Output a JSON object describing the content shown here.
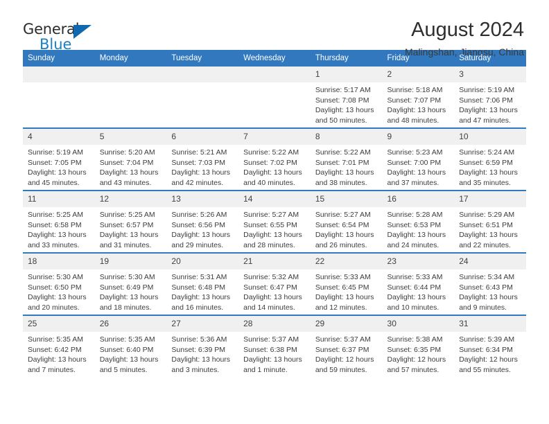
{
  "brand": {
    "name_top": "General",
    "name_bottom": "Blue",
    "mark": "triangle-logo"
  },
  "header": {
    "title": "August 2024",
    "subtitle": "Malingshan, Jiangsu, China"
  },
  "colors": {
    "header_bar": "#3278be",
    "brand_blue": "#1b7fc4",
    "daynum_bg": "#f0f0f0",
    "text": "#3c3c3c"
  },
  "weekdays": [
    "Sunday",
    "Monday",
    "Tuesday",
    "Wednesday",
    "Thursday",
    "Friday",
    "Saturday"
  ],
  "weeks": [
    [
      {
        "day": "",
        "sunrise": "",
        "sunset": "",
        "daylight_line1": "",
        "daylight_line2": ""
      },
      {
        "day": "",
        "sunrise": "",
        "sunset": "",
        "daylight_line1": "",
        "daylight_line2": ""
      },
      {
        "day": "",
        "sunrise": "",
        "sunset": "",
        "daylight_line1": "",
        "daylight_line2": ""
      },
      {
        "day": "",
        "sunrise": "",
        "sunset": "",
        "daylight_line1": "",
        "daylight_line2": ""
      },
      {
        "day": "1",
        "sunrise": "Sunrise: 5:17 AM",
        "sunset": "Sunset: 7:08 PM",
        "daylight_line1": "Daylight: 13 hours",
        "daylight_line2": "and 50 minutes."
      },
      {
        "day": "2",
        "sunrise": "Sunrise: 5:18 AM",
        "sunset": "Sunset: 7:07 PM",
        "daylight_line1": "Daylight: 13 hours",
        "daylight_line2": "and 48 minutes."
      },
      {
        "day": "3",
        "sunrise": "Sunrise: 5:19 AM",
        "sunset": "Sunset: 7:06 PM",
        "daylight_line1": "Daylight: 13 hours",
        "daylight_line2": "and 47 minutes."
      }
    ],
    [
      {
        "day": "4",
        "sunrise": "Sunrise: 5:19 AM",
        "sunset": "Sunset: 7:05 PM",
        "daylight_line1": "Daylight: 13 hours",
        "daylight_line2": "and 45 minutes."
      },
      {
        "day": "5",
        "sunrise": "Sunrise: 5:20 AM",
        "sunset": "Sunset: 7:04 PM",
        "daylight_line1": "Daylight: 13 hours",
        "daylight_line2": "and 43 minutes."
      },
      {
        "day": "6",
        "sunrise": "Sunrise: 5:21 AM",
        "sunset": "Sunset: 7:03 PM",
        "daylight_line1": "Daylight: 13 hours",
        "daylight_line2": "and 42 minutes."
      },
      {
        "day": "7",
        "sunrise": "Sunrise: 5:22 AM",
        "sunset": "Sunset: 7:02 PM",
        "daylight_line1": "Daylight: 13 hours",
        "daylight_line2": "and 40 minutes."
      },
      {
        "day": "8",
        "sunrise": "Sunrise: 5:22 AM",
        "sunset": "Sunset: 7:01 PM",
        "daylight_line1": "Daylight: 13 hours",
        "daylight_line2": "and 38 minutes."
      },
      {
        "day": "9",
        "sunrise": "Sunrise: 5:23 AM",
        "sunset": "Sunset: 7:00 PM",
        "daylight_line1": "Daylight: 13 hours",
        "daylight_line2": "and 37 minutes."
      },
      {
        "day": "10",
        "sunrise": "Sunrise: 5:24 AM",
        "sunset": "Sunset: 6:59 PM",
        "daylight_line1": "Daylight: 13 hours",
        "daylight_line2": "and 35 minutes."
      }
    ],
    [
      {
        "day": "11",
        "sunrise": "Sunrise: 5:25 AM",
        "sunset": "Sunset: 6:58 PM",
        "daylight_line1": "Daylight: 13 hours",
        "daylight_line2": "and 33 minutes."
      },
      {
        "day": "12",
        "sunrise": "Sunrise: 5:25 AM",
        "sunset": "Sunset: 6:57 PM",
        "daylight_line1": "Daylight: 13 hours",
        "daylight_line2": "and 31 minutes."
      },
      {
        "day": "13",
        "sunrise": "Sunrise: 5:26 AM",
        "sunset": "Sunset: 6:56 PM",
        "daylight_line1": "Daylight: 13 hours",
        "daylight_line2": "and 29 minutes."
      },
      {
        "day": "14",
        "sunrise": "Sunrise: 5:27 AM",
        "sunset": "Sunset: 6:55 PM",
        "daylight_line1": "Daylight: 13 hours",
        "daylight_line2": "and 28 minutes."
      },
      {
        "day": "15",
        "sunrise": "Sunrise: 5:27 AM",
        "sunset": "Sunset: 6:54 PM",
        "daylight_line1": "Daylight: 13 hours",
        "daylight_line2": "and 26 minutes."
      },
      {
        "day": "16",
        "sunrise": "Sunrise: 5:28 AM",
        "sunset": "Sunset: 6:53 PM",
        "daylight_line1": "Daylight: 13 hours",
        "daylight_line2": "and 24 minutes."
      },
      {
        "day": "17",
        "sunrise": "Sunrise: 5:29 AM",
        "sunset": "Sunset: 6:51 PM",
        "daylight_line1": "Daylight: 13 hours",
        "daylight_line2": "and 22 minutes."
      }
    ],
    [
      {
        "day": "18",
        "sunrise": "Sunrise: 5:30 AM",
        "sunset": "Sunset: 6:50 PM",
        "daylight_line1": "Daylight: 13 hours",
        "daylight_line2": "and 20 minutes."
      },
      {
        "day": "19",
        "sunrise": "Sunrise: 5:30 AM",
        "sunset": "Sunset: 6:49 PM",
        "daylight_line1": "Daylight: 13 hours",
        "daylight_line2": "and 18 minutes."
      },
      {
        "day": "20",
        "sunrise": "Sunrise: 5:31 AM",
        "sunset": "Sunset: 6:48 PM",
        "daylight_line1": "Daylight: 13 hours",
        "daylight_line2": "and 16 minutes."
      },
      {
        "day": "21",
        "sunrise": "Sunrise: 5:32 AM",
        "sunset": "Sunset: 6:47 PM",
        "daylight_line1": "Daylight: 13 hours",
        "daylight_line2": "and 14 minutes."
      },
      {
        "day": "22",
        "sunrise": "Sunrise: 5:33 AM",
        "sunset": "Sunset: 6:45 PM",
        "daylight_line1": "Daylight: 13 hours",
        "daylight_line2": "and 12 minutes."
      },
      {
        "day": "23",
        "sunrise": "Sunrise: 5:33 AM",
        "sunset": "Sunset: 6:44 PM",
        "daylight_line1": "Daylight: 13 hours",
        "daylight_line2": "and 10 minutes."
      },
      {
        "day": "24",
        "sunrise": "Sunrise: 5:34 AM",
        "sunset": "Sunset: 6:43 PM",
        "daylight_line1": "Daylight: 13 hours",
        "daylight_line2": "and 9 minutes."
      }
    ],
    [
      {
        "day": "25",
        "sunrise": "Sunrise: 5:35 AM",
        "sunset": "Sunset: 6:42 PM",
        "daylight_line1": "Daylight: 13 hours",
        "daylight_line2": "and 7 minutes."
      },
      {
        "day": "26",
        "sunrise": "Sunrise: 5:35 AM",
        "sunset": "Sunset: 6:40 PM",
        "daylight_line1": "Daylight: 13 hours",
        "daylight_line2": "and 5 minutes."
      },
      {
        "day": "27",
        "sunrise": "Sunrise: 5:36 AM",
        "sunset": "Sunset: 6:39 PM",
        "daylight_line1": "Daylight: 13 hours",
        "daylight_line2": "and 3 minutes."
      },
      {
        "day": "28",
        "sunrise": "Sunrise: 5:37 AM",
        "sunset": "Sunset: 6:38 PM",
        "daylight_line1": "Daylight: 13 hours",
        "daylight_line2": "and 1 minute."
      },
      {
        "day": "29",
        "sunrise": "Sunrise: 5:37 AM",
        "sunset": "Sunset: 6:37 PM",
        "daylight_line1": "Daylight: 12 hours",
        "daylight_line2": "and 59 minutes."
      },
      {
        "day": "30",
        "sunrise": "Sunrise: 5:38 AM",
        "sunset": "Sunset: 6:35 PM",
        "daylight_line1": "Daylight: 12 hours",
        "daylight_line2": "and 57 minutes."
      },
      {
        "day": "31",
        "sunrise": "Sunrise: 5:39 AM",
        "sunset": "Sunset: 6:34 PM",
        "daylight_line1": "Daylight: 12 hours",
        "daylight_line2": "and 55 minutes."
      }
    ]
  ]
}
